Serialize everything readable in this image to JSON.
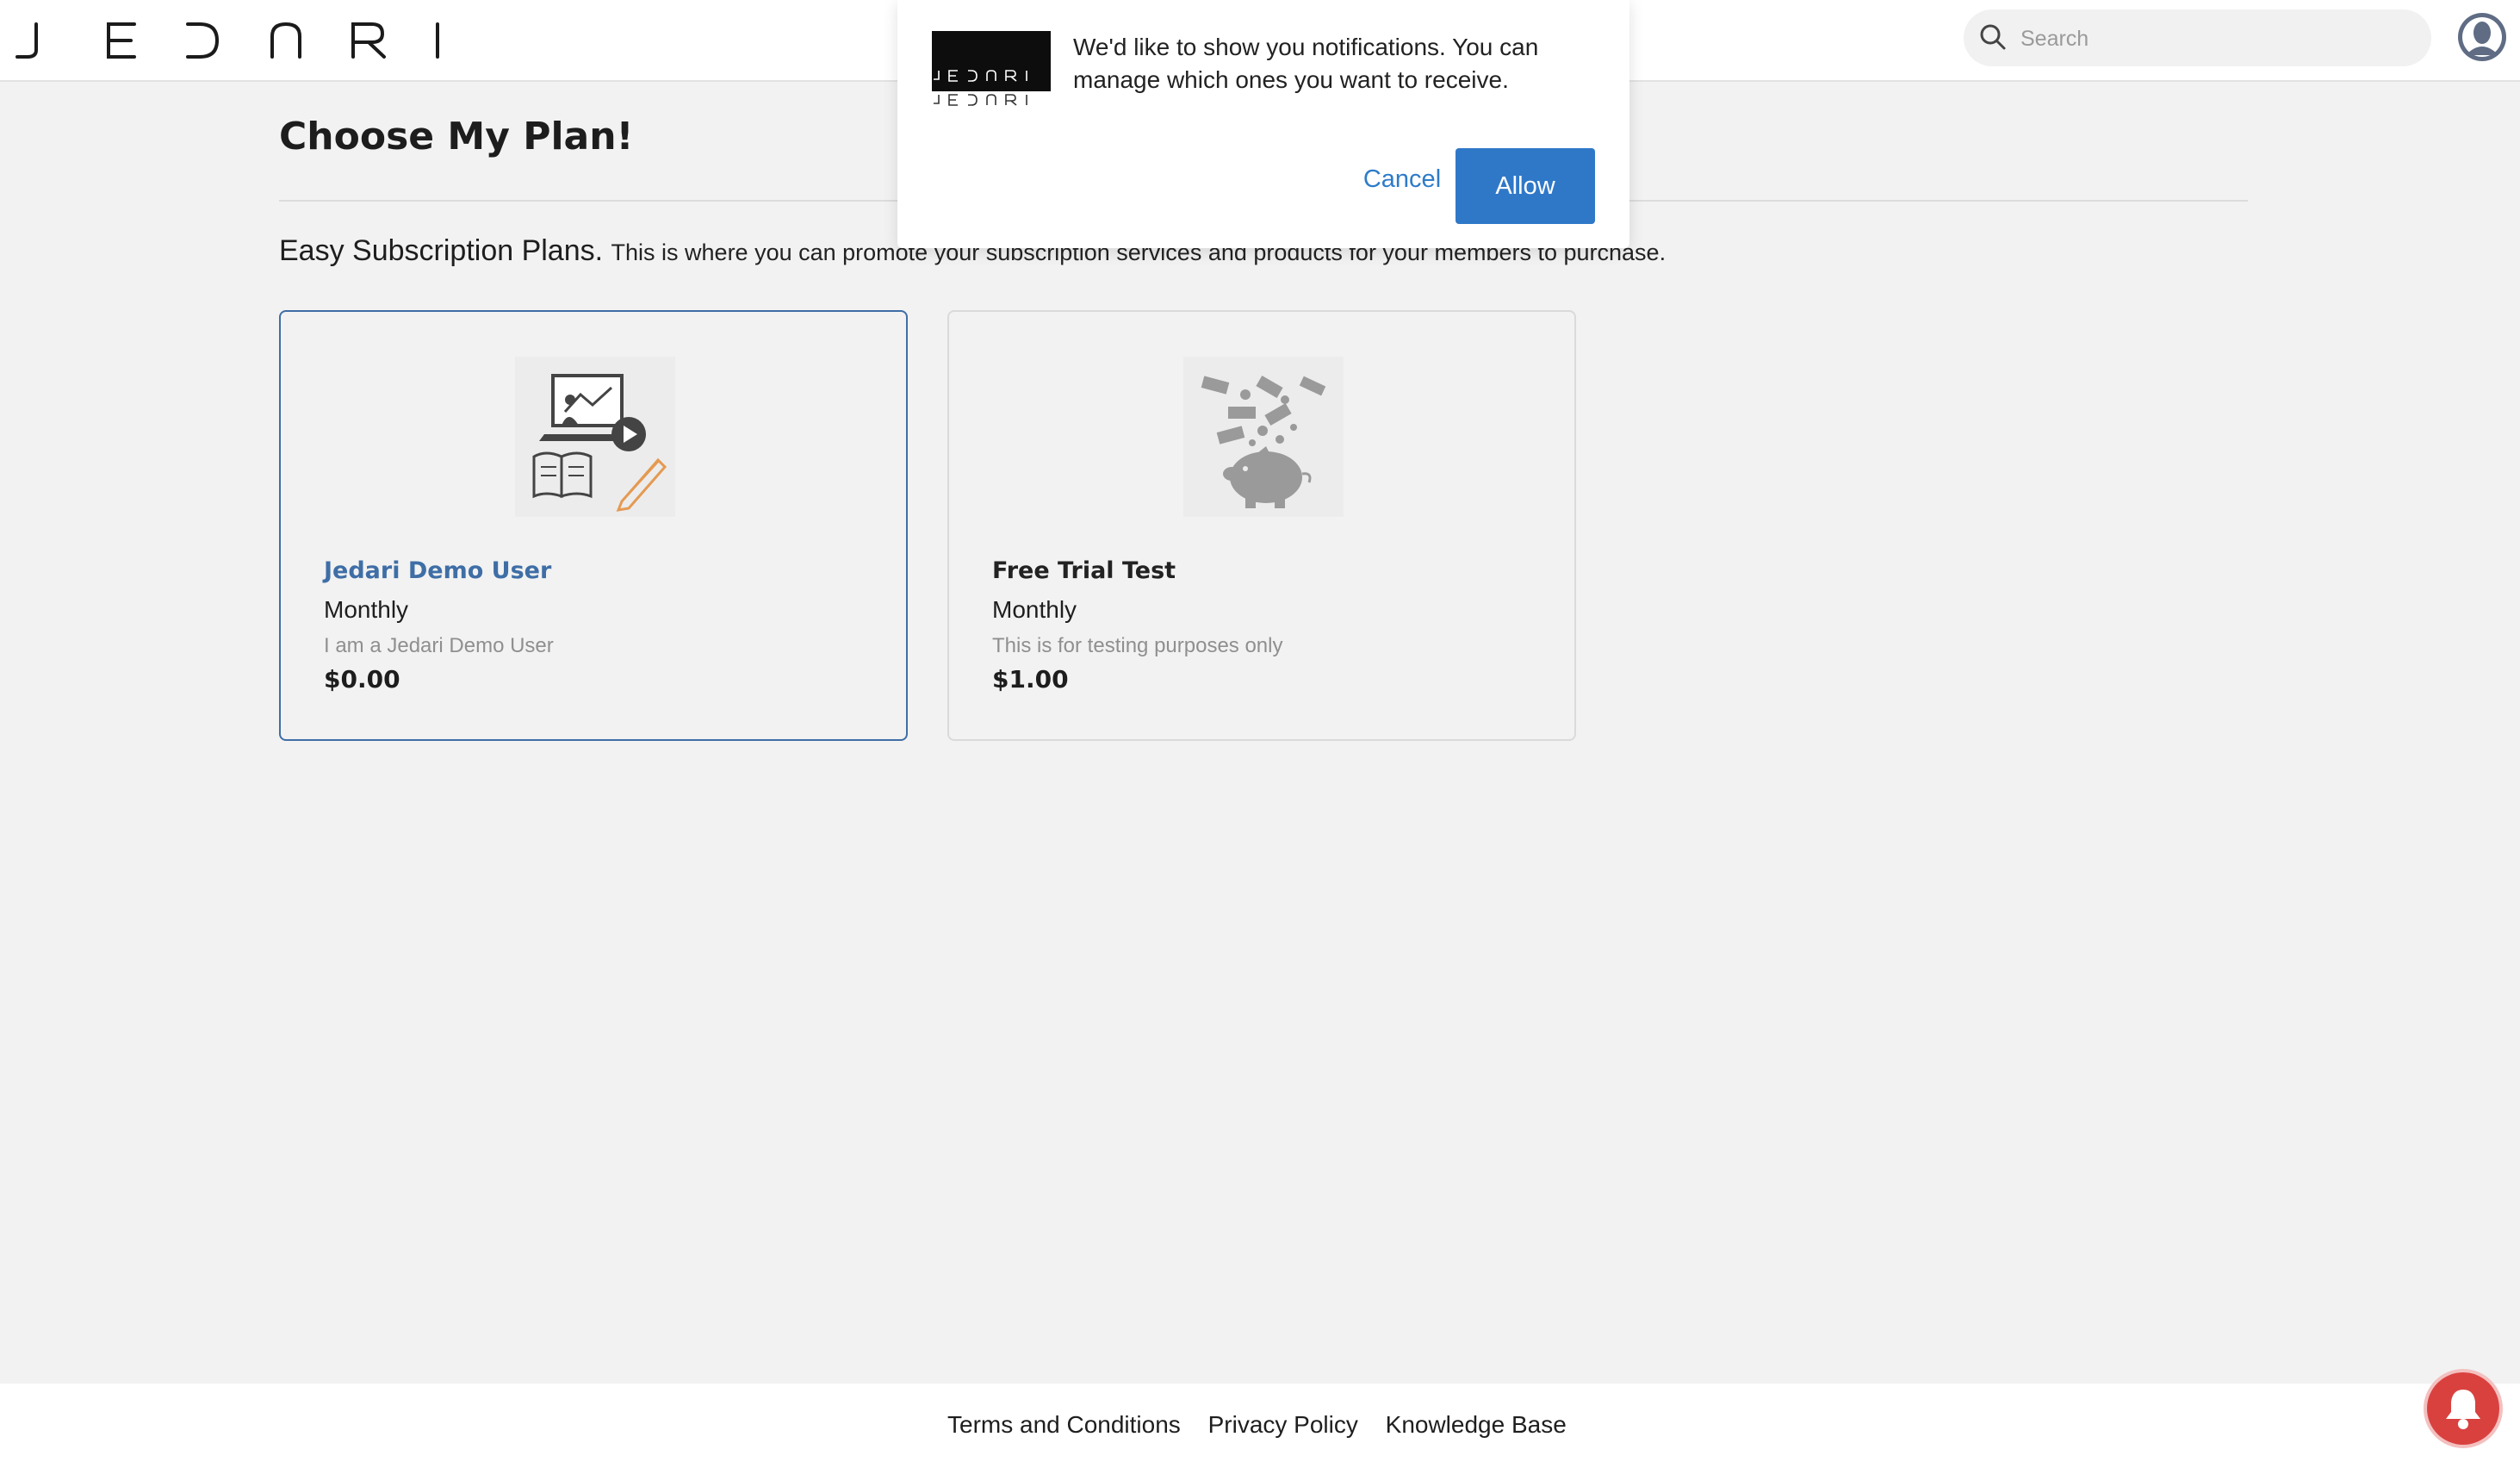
{
  "header": {
    "logo_text": "JEDARI",
    "search": {
      "placeholder": "Search",
      "value": ""
    }
  },
  "main": {
    "title": "Choose My Plan!",
    "subtitle_lead": "Easy Subscription Plans.",
    "subtitle_desc": "This is where you can promote your subscription services and products for your members to purchase.",
    "plans": [
      {
        "name": "Jedari Demo User",
        "period": "Monthly",
        "description": "I am a Jedari Demo User",
        "price": "$0.00",
        "selected": true,
        "image_icon": "online-learning-icon"
      },
      {
        "name": "Free Trial Test",
        "period": "Monthly",
        "description": "This is for testing purposes only",
        "price": "$1.00",
        "selected": false,
        "image_icon": "piggy-bank-money-icon"
      }
    ]
  },
  "notification_prompt": {
    "logo_text": "JEDARI",
    "message": "We'd like to show you notifications. You can manage which ones you want to receive.",
    "cancel_label": "Cancel",
    "allow_label": "Allow"
  },
  "footer": {
    "links": [
      "Terms and Conditions",
      "Privacy Policy",
      "Knowledge Base"
    ]
  },
  "colors": {
    "accent": "#2f78c8",
    "selected_border": "#3f6ea6",
    "bell": "#d9413f"
  }
}
